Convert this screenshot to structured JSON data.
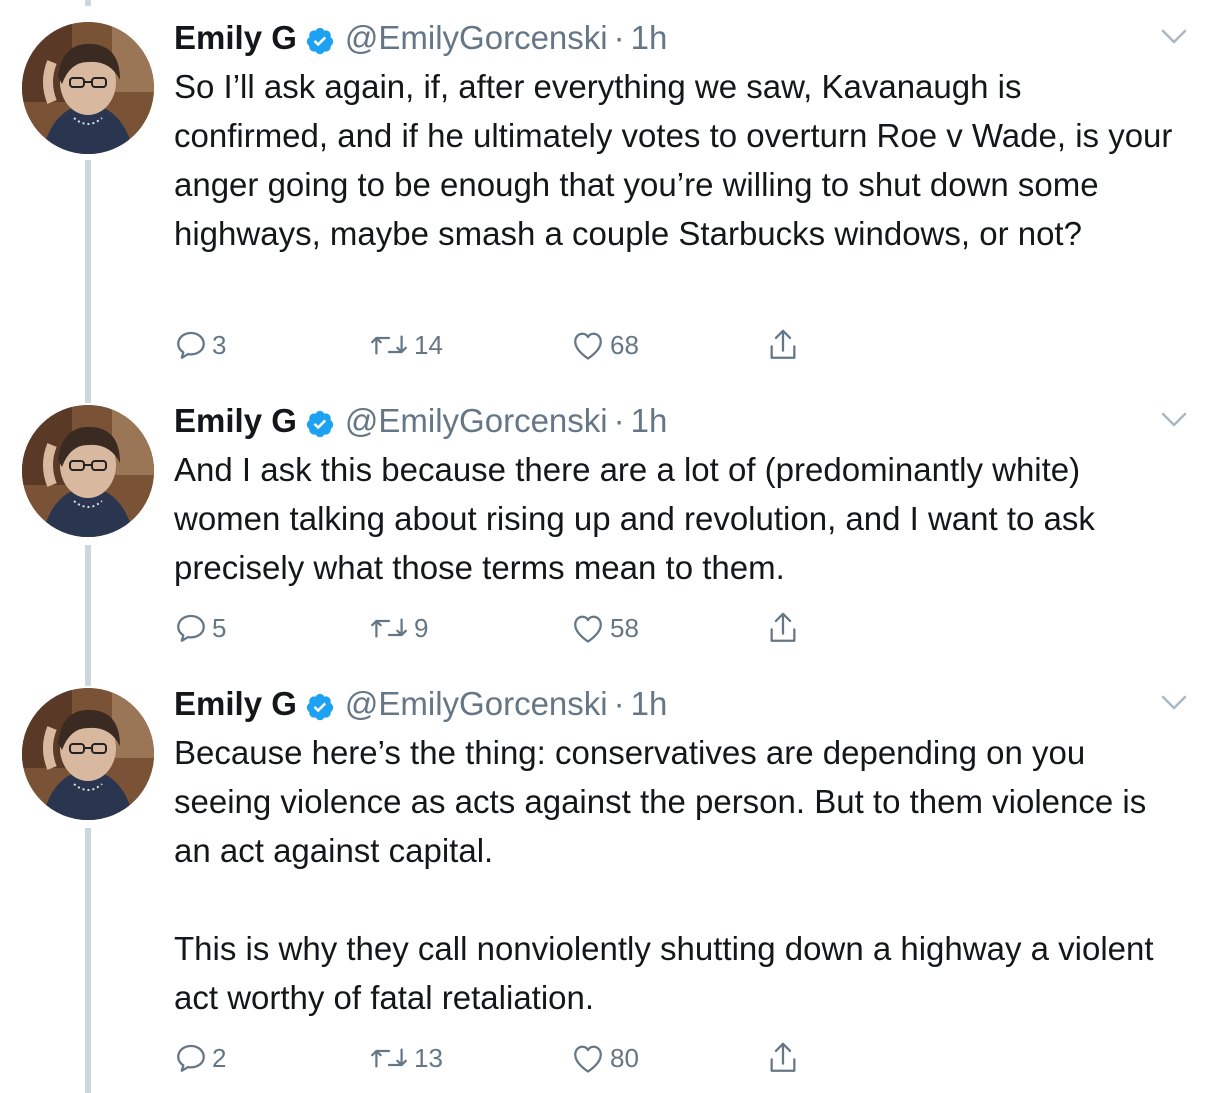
{
  "colors": {
    "text": "#14171a",
    "secondary": "#657786",
    "verified": "#1da1f2",
    "thread_line": "#ccd6dd"
  },
  "tweets": [
    {
      "author": {
        "name": "Emily G",
        "handle": "@EmilyGorcenski",
        "verified": true
      },
      "separator": "·",
      "time": "1h",
      "text": [
        "So I’ll ask again, if, after everything we saw, Kavanaugh is confirmed, and if he ultimately votes to overturn Roe v Wade, is your anger going to be enough that you’re willing to shut down some highways, maybe smash a couple Starbucks windows, or not?"
      ],
      "counts": {
        "replies": "3",
        "retweets": "14",
        "likes": "68"
      }
    },
    {
      "author": {
        "name": "Emily G",
        "handle": "@EmilyGorcenski",
        "verified": true
      },
      "separator": "·",
      "time": "1h",
      "text": [
        "And I ask this because there are a lot of (predominantly white) women talking about rising up and revolution, and I want to ask precisely what those terms mean to them."
      ],
      "counts": {
        "replies": "5",
        "retweets": "9",
        "likes": "58"
      }
    },
    {
      "author": {
        "name": "Emily G",
        "handle": "@EmilyGorcenski",
        "verified": true
      },
      "separator": "·",
      "time": "1h",
      "text": [
        "Because here’s the thing: conservatives are depending on you seeing violence as acts against the person. But to them violence is an act against capital.",
        "This is why they call nonviolently shutting down a highway a violent act worthy of fatal retaliation."
      ],
      "counts": {
        "replies": "2",
        "retweets": "13",
        "likes": "80"
      }
    }
  ],
  "icons": {
    "reply": "reply-icon",
    "retweet": "retweet-icon",
    "like": "heart-icon",
    "share": "share-icon",
    "verified": "verified-badge-icon",
    "menu": "chevron-down-icon"
  }
}
